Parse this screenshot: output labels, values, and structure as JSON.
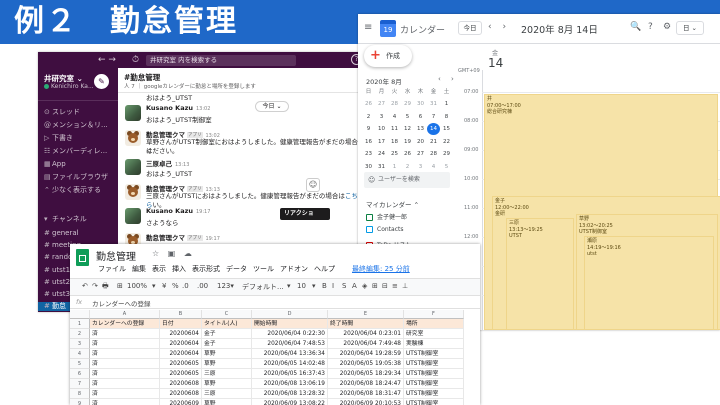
{
  "banner": {
    "title": "例２　勤怠管理"
  },
  "slack": {
    "nav": {
      "arrows": "← →",
      "clock": "⏱"
    },
    "search_placeholder": "井研究室 内を検索する",
    "help": "?",
    "workspace": {
      "name": "井研究室",
      "user": "Kenichiro Ka..."
    },
    "sidebar": [
      {
        "icon": "thread-icon",
        "glyph": "⊙",
        "label": "スレッド"
      },
      {
        "icon": "mention-icon",
        "glyph": "@",
        "label": "メンション＆リ..."
      },
      {
        "icon": "draft-icon",
        "glyph": "▷",
        "label": "下書き"
      },
      {
        "icon": "members-icon",
        "glyph": "☷",
        "label": "メンバーディレ..."
      },
      {
        "icon": "apps-icon",
        "glyph": "▦",
        "label": "App"
      },
      {
        "icon": "file-icon",
        "glyph": "▤",
        "label": "ファイルブラウザ"
      },
      {
        "icon": "less-icon",
        "glyph": "⌃",
        "label": "少なく表示する"
      }
    ],
    "channels_header": "チャンネル",
    "channels": [
      "general",
      "meeting",
      "random",
      "utst1",
      "utst2",
      "utst3",
      "勤怠"
    ],
    "main": {
      "title": "#勤怠管理",
      "topic": "人 7 ｜ googleカレンダーに勤怠と場所を登録します",
      "date_pill": "今日 ⌄",
      "messages": [
        {
          "type": "text",
          "text": "おはよう_UTST"
        },
        {
          "type": "author",
          "name": "Kusano Kazu",
          "app": "",
          "time": "13:02"
        },
        {
          "type": "text",
          "text": "おはよう_UTST制御室"
        },
        {
          "type": "author",
          "name": "勤怠管理クマ",
          "app": "アプリ",
          "time": "13:02"
        },
        {
          "type": "wrap",
          "text": "草野さんがUTST制御室におはようしました。健康管理報告がまだの場合は",
          "link": "",
          "tail": ""
        },
        {
          "type": "wrap",
          "text": "ください。",
          "link": "",
          "tail": ""
        },
        {
          "type": "author",
          "name": "三原卓己",
          "app": "",
          "time": "13:13"
        },
        {
          "type": "text",
          "text": "おはよう_UTST"
        },
        {
          "type": "author",
          "name": "勤怠管理クマ",
          "app": "アプリ",
          "time": "13:13"
        },
        {
          "type": "wrap",
          "text": "三原さんがUTSTにおはようしました。健康管理報告がまだの場合は",
          "link": "こちら",
          "tail": "い。"
        },
        {
          "type": "author",
          "name": "Kusano Kazu",
          "app": "",
          "time": "19:17"
        },
        {
          "type": "text",
          "text": "さようなら"
        },
        {
          "type": "author",
          "name": "勤怠管理クマ",
          "app": "アプリ",
          "time": "19:17"
        }
      ],
      "tooltip": "リアクショ",
      "reaction_icon": "☺"
    }
  },
  "gcal": {
    "menu": "≡",
    "logo_num": "19",
    "app_title": "カレンダー",
    "today_btn": "今日",
    "arrows": "‹ ›",
    "date": "2020年 8月 14日",
    "icons": [
      "🔍",
      "?",
      "⚙"
    ],
    "view": "日 ⌄",
    "create": "作成",
    "mini_month": "2020年 8月",
    "mini_nav": "‹ ›",
    "weekdays": [
      "日",
      "月",
      "火",
      "水",
      "木",
      "金",
      "土"
    ],
    "weeks": [
      [
        "26",
        "27",
        "28",
        "29",
        "30",
        "31",
        "1"
      ],
      [
        "2",
        "3",
        "4",
        "5",
        "6",
        "7",
        "8"
      ],
      [
        "9",
        "10",
        "11",
        "12",
        "13",
        "14",
        "15"
      ],
      [
        "16",
        "17",
        "18",
        "19",
        "20",
        "21",
        "22"
      ],
      [
        "23",
        "24",
        "25",
        "26",
        "27",
        "28",
        "29"
      ],
      [
        "30",
        "31",
        "1",
        "2",
        "3",
        "4",
        "5"
      ]
    ],
    "today_date": "14",
    "search_people": "ユーザーを検索",
    "my_calendars": "マイカレンダー",
    "calendars": [
      {
        "name": "金子健一郎",
        "color": "#0b8043"
      },
      {
        "name": "Contacts",
        "color": "#039be5"
      },
      {
        "name": "ToDo リスト",
        "color": "#d50000"
      }
    ],
    "day_label": "金",
    "day_num": "14",
    "tz": "GMT+09",
    "hours": [
      "07:00",
      "08:00",
      "09:00",
      "10:00",
      "11:00",
      "12:00",
      "13:00",
      "14:00"
    ],
    "events": [
      {
        "lines": [
          "井",
          "07:00～17:00",
          "総合研究棟"
        ]
      },
      {
        "lines": [
          "金子",
          "12:00～22:00",
          "金研"
        ]
      },
      {
        "lines": [
          "三原",
          "13:13～19:25",
          "UTST"
        ]
      },
      {
        "lines": [
          "草野",
          "13:02～20:25",
          "UTST制御室"
        ]
      },
      {
        "lines": [
          "瀬原",
          "14:19～19:16",
          "utst"
        ]
      }
    ]
  },
  "sheets": {
    "title": "勤怠管理",
    "title_icons": "☆ ▣ ☁",
    "menus": [
      "ファイル",
      "編集",
      "表示",
      "挿入",
      "表示形式",
      "データ",
      "ツール",
      "アドオン",
      "ヘルプ"
    ],
    "last_edit": "最終編集: 25 分前",
    "toolbar": [
      "↶",
      "↷",
      "🖶",
      "⊞",
      "100%",
      "▾",
      "¥",
      "%",
      ".0",
      ".00",
      "123▾",
      "デフォルト...",
      "▾",
      "10",
      "▾",
      "B",
      "I",
      "S",
      "A",
      "◈",
      "⊞",
      "⊟",
      "≡",
      "⊥"
    ],
    "fx": "fx",
    "fx_value": "カレンダーへの登録",
    "columns": [
      "A",
      "B",
      "C",
      "D",
      "E",
      "F"
    ],
    "headers": [
      "カレンダーへの登録",
      "日付",
      "タイトル(人)",
      "開始時間",
      "終了時間",
      "場所"
    ],
    "rows": [
      [
        "済",
        "20200604",
        "金子",
        "2020/06/04 0:22:30",
        "2020/06/04 0:23:01",
        "研究室"
      ],
      [
        "済",
        "20200604",
        "金子",
        "2020/06/04 7:48:53",
        "2020/06/04 7:49:48",
        "実験棟"
      ],
      [
        "済",
        "20200604",
        "草野",
        "2020/06/04 13:36:34",
        "2020/06/04 19:28:59",
        "UTST制御室"
      ],
      [
        "済",
        "20200605",
        "草野",
        "2020/06/05 14:02:48",
        "2020/06/05 19:05:38",
        "UTST制御室"
      ],
      [
        "済",
        "20200605",
        "三原",
        "2020/06/05 16:37:43",
        "2020/06/05 18:29:34",
        "UTST制御室"
      ],
      [
        "済",
        "20200608",
        "草野",
        "2020/06/08 13:06:19",
        "2020/06/08 18:24:47",
        "UTST制御室"
      ],
      [
        "済",
        "20200608",
        "三原",
        "2020/06/08 13:28:32",
        "2020/06/08 18:31:47",
        "UTST制御室"
      ],
      [
        "済",
        "20200609",
        "草野",
        "2020/06/09 13:08:22",
        "2020/06/09 20:10:53",
        "UTST制御室"
      ]
    ]
  }
}
